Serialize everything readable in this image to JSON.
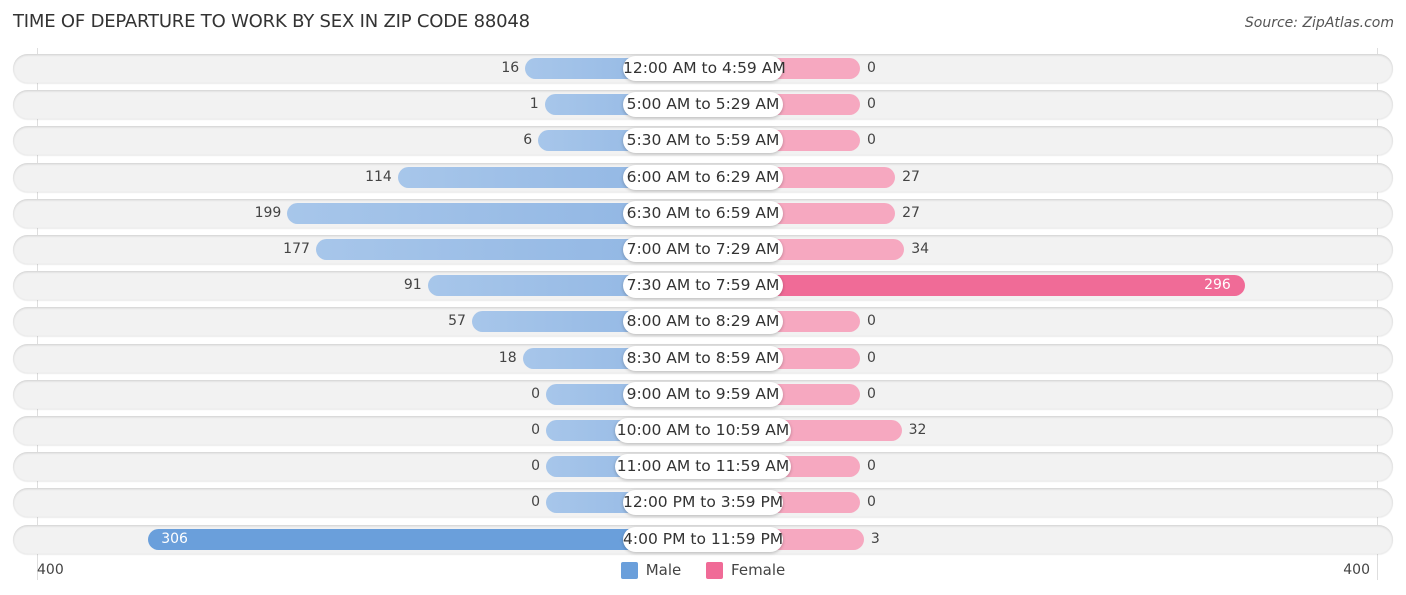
{
  "chart_data": {
    "type": "bar",
    "orientation": "horizontal-diverging",
    "title": "TIME OF DEPARTURE TO WORK BY SEX IN ZIP CODE 88048",
    "source": "Source: ZipAtlas.com",
    "categories": [
      "12:00 AM to 4:59 AM",
      "5:00 AM to 5:29 AM",
      "5:30 AM to 5:59 AM",
      "6:00 AM to 6:29 AM",
      "6:30 AM to 6:59 AM",
      "7:00 AM to 7:29 AM",
      "7:30 AM to 7:59 AM",
      "8:00 AM to 8:29 AM",
      "8:30 AM to 8:59 AM",
      "9:00 AM to 9:59 AM",
      "10:00 AM to 10:59 AM",
      "11:00 AM to 11:59 AM",
      "12:00 PM to 3:59 PM",
      "4:00 PM to 11:59 PM"
    ],
    "series": [
      {
        "name": "Male",
        "color": "#6a9fdb",
        "values": [
          16,
          1,
          6,
          114,
          199,
          177,
          91,
          57,
          18,
          0,
          0,
          0,
          0,
          306
        ]
      },
      {
        "name": "Female",
        "color": "#f06b97",
        "values": [
          0,
          0,
          0,
          27,
          27,
          34,
          296,
          0,
          0,
          0,
          32,
          0,
          0,
          3
        ]
      }
    ],
    "xlim": [
      -400,
      400
    ],
    "tick_labels": {
      "left": "400",
      "right": "400"
    },
    "legend_position": "bottom-center",
    "grid": false
  }
}
